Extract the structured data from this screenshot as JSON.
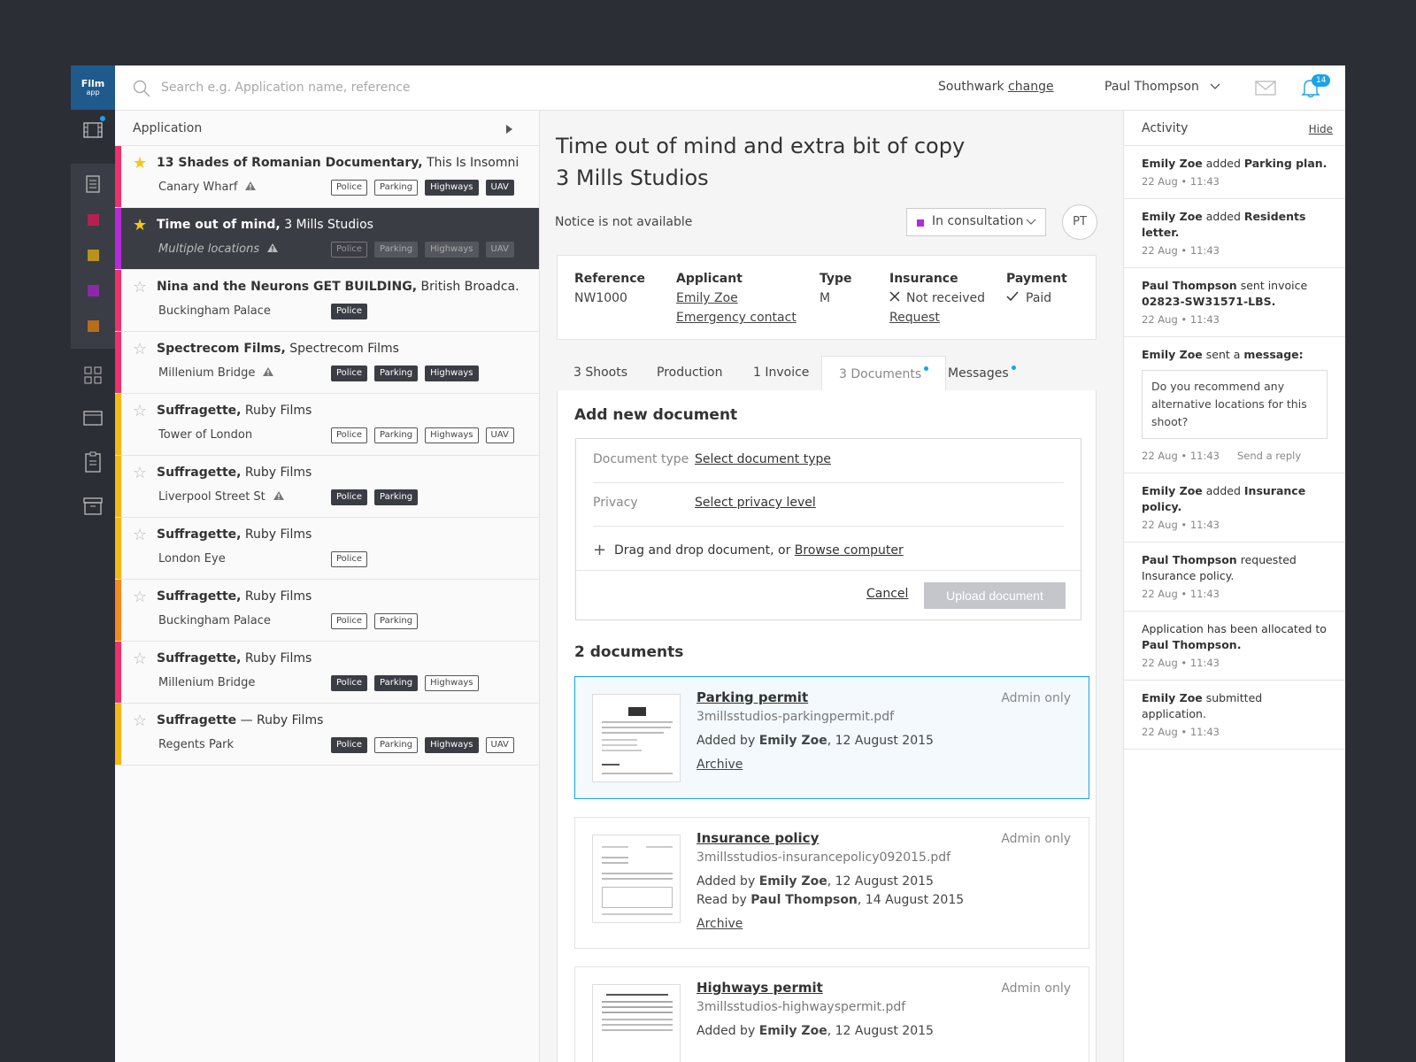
{
  "logo": {
    "line1": "Film",
    "line2": "app"
  },
  "search": {
    "placeholder": "Search e.g. Application name, reference"
  },
  "header": {
    "council": "Southwark",
    "change_label": "change",
    "user": "Paul Thompson",
    "notifications": "14"
  },
  "list": {
    "header": "Application"
  },
  "applications": [
    {
      "title": "13 Shades of Romanian Documentary,",
      "company": "This Is Insomnia",
      "location": "Canary Wharf",
      "warning": true,
      "starred": true,
      "color": "#f0306c",
      "tags": [
        {
          "label": "Police",
          "dark": false
        },
        {
          "label": "Parking",
          "dark": false
        },
        {
          "label": "Highways",
          "dark": true
        },
        {
          "label": "UAV",
          "dark": true
        }
      ]
    },
    {
      "title": "Time out of mind,",
      "company": "3 Mills Studios",
      "location": "Multiple locations",
      "warning": true,
      "starred": true,
      "color": "#b52ad9",
      "selected": true,
      "tags": [
        {
          "label": "Police",
          "dark": false
        },
        {
          "label": "Parking",
          "dark": true
        },
        {
          "label": "Highways",
          "dark": true
        },
        {
          "label": "UAV",
          "dark": true
        }
      ]
    },
    {
      "title": "Nina and the Neurons GET BUILDING,",
      "company": "British Broadca...",
      "location": "Buckingham Palace",
      "warning": false,
      "starred": false,
      "color": "#f0306c",
      "tags": [
        {
          "label": "Police",
          "dark": true
        }
      ]
    },
    {
      "title": "Spectrecom Films,",
      "company": "Spectrecom Films",
      "location": "Millenium Bridge",
      "warning": true,
      "starred": false,
      "color": "#f0306c",
      "tags": [
        {
          "label": "Police",
          "dark": true
        },
        {
          "label": "Parking",
          "dark": true
        },
        {
          "label": "Highways",
          "dark": true
        }
      ]
    },
    {
      "title": "Suffragette,",
      "company": "Ruby Films",
      "location": "Tower of London",
      "warning": false,
      "starred": false,
      "color": "#f7b816",
      "tags": [
        {
          "label": "Police",
          "dark": false
        },
        {
          "label": "Parking",
          "dark": false
        },
        {
          "label": "Highways",
          "dark": false
        },
        {
          "label": "UAV",
          "dark": false
        }
      ]
    },
    {
      "title": "Suffragette,",
      "company": "Ruby Films",
      "location": "Liverpool Street St",
      "warning": true,
      "starred": false,
      "color": "#f7b816",
      "tags": [
        {
          "label": "Police",
          "dark": true
        },
        {
          "label": "Parking",
          "dark": true
        }
      ]
    },
    {
      "title": "Suffragette,",
      "company": "Ruby Films",
      "location": "London Eye",
      "warning": false,
      "starred": false,
      "color": "#f7b816",
      "tags": [
        {
          "label": "Police",
          "dark": false
        }
      ]
    },
    {
      "title": "Suffragette,",
      "company": "Ruby Films",
      "location": "Buckingham Palace",
      "warning": false,
      "starred": false,
      "color": "#f78a1d",
      "tags": [
        {
          "label": "Police",
          "dark": false
        },
        {
          "label": "Parking",
          "dark": false
        }
      ]
    },
    {
      "title": "Suffragette,",
      "company": "Ruby Films",
      "location": "Millenium Bridge",
      "warning": false,
      "starred": false,
      "color": "#f0306c",
      "tags": [
        {
          "label": "Police",
          "dark": true
        },
        {
          "label": "Parking",
          "dark": true
        },
        {
          "label": "Highways",
          "dark": false
        }
      ]
    },
    {
      "title": "Suffragette",
      "company": "— Ruby Films",
      "location": "Regents Park",
      "warning": false,
      "starred": false,
      "color": "#f7b816",
      "tags": [
        {
          "label": "Police",
          "dark": true
        },
        {
          "label": "Parking",
          "dark": false
        },
        {
          "label": "Highways",
          "dark": true
        },
        {
          "label": "UAV",
          "dark": false
        }
      ]
    }
  ],
  "detail": {
    "title": "Time out of mind and extra bit of copy",
    "subtitle": "3 Mills Studios",
    "notice": "Notice is not available",
    "status": "In consultation",
    "status_color": "#b52ad9",
    "assignee_initials": "PT",
    "reference_label": "Reference",
    "reference": "NW1000",
    "applicant_label": "Applicant",
    "applicant": "Emily Zoe",
    "emergency": "Emergency contact",
    "type_label": "Type",
    "type": "M",
    "insurance_label": "Insurance",
    "insurance": "Not received",
    "insurance_request": "Request",
    "payment_label": "Payment",
    "payment": "Paid"
  },
  "tabs": [
    "3 Shoots",
    "Production",
    "1 Invoice",
    "3 Documents",
    "Messages"
  ],
  "add_document": {
    "title": "Add new document",
    "doc_type_label": "Document type",
    "doc_type_value": "Select document type",
    "privacy_label": "Privacy",
    "privacy_value": "Select privacy level",
    "drop_text": "Drag and drop document, or",
    "browse": "Browse computer",
    "cancel": "Cancel",
    "upload": "Upload document"
  },
  "documents_title": "2 documents",
  "documents": [
    {
      "name": "Parking permit",
      "file": "3millsstudios-parkingpermit.pdf",
      "added_prefix": "Added by",
      "added_by": "Emily Zoe",
      "added_date": ", 12 August 2015",
      "access": "Admin only",
      "archive": "Archive"
    },
    {
      "name": "Insurance policy",
      "file": "3millsstudios-insurancepolicy092015.pdf",
      "added_prefix": "Added by",
      "added_by": "Emily Zoe",
      "added_date": ", 12 August 2015",
      "read_prefix": "Read by",
      "read_by": "Paul Thompson",
      "read_date": ", 14 August 2015",
      "access": "Admin only",
      "archive": "Archive"
    },
    {
      "name": "Highways permit",
      "file": "3millsstudios-highwayspermit.pdf",
      "added_prefix": "Added by",
      "added_by": "Emily Zoe",
      "added_date": ", 12 August 2015",
      "access": "Admin only"
    }
  ],
  "activity": {
    "title": "Activity",
    "hide": "Hide",
    "items": [
      {
        "who": "Emily Zoe",
        "verb": "added",
        "what": "Parking plan.",
        "time": "22 Aug • 11:43"
      },
      {
        "who": "Emily Zoe",
        "verb": "added",
        "what": "Residents letter.",
        "time": "22 Aug • 11:43"
      },
      {
        "who": "Paul Thompson",
        "verb": "sent invoice",
        "what": "02823-SW31571-LBS.",
        "time": "22 Aug • 11:43"
      },
      {
        "who": "Emily Zoe",
        "verb": "sent a",
        "what": "message:",
        "message": "Do you recommend any alternative locations for this shoot?",
        "time": "22 Aug • 11:43",
        "reply": "Send a reply"
      },
      {
        "who": "Emily Zoe",
        "verb": "added",
        "what": "Insurance policy.",
        "time": "22 Aug • 11:43"
      },
      {
        "who": "Paul Thompson",
        "verb": "requested",
        "what": "",
        "tail": "Insurance policy.",
        "time": "22 Aug • 11:43"
      },
      {
        "who": "",
        "verb": "Application has been allocated to",
        "what": "Paul Thompson.",
        "time": "22 Aug • 11:43"
      },
      {
        "who": "Emily Zoe",
        "verb": "submitted application.",
        "what": "",
        "time": "22 Aug • 11:43"
      }
    ]
  }
}
